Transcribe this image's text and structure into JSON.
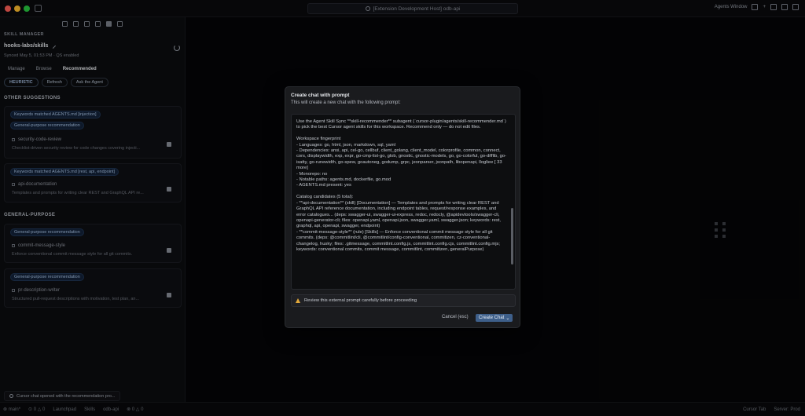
{
  "window": {
    "search_text": "[Extension Development Host] odb-api",
    "right_label": "Agents Window"
  },
  "sidebar": {
    "section_title": "SKILL MANAGER",
    "repo": "hooks-labs/skills",
    "synced": "Synced May 5, 01:53 PM · QS enabled",
    "tabs": [
      "Manage",
      "Browse",
      "Recommended"
    ],
    "active_tab": "Recommended",
    "pills": [
      "HEURISTIC",
      "Refresh",
      "Ask the Agent"
    ],
    "other_title": "OTHER SUGGESTIONS",
    "general_title": "GENERAL-PURPOSE",
    "other_cards": [
      {
        "tags": [
          "Keywords matched AGENTS.md [injection]",
          "General-purpose recommendation"
        ],
        "name": "security-code-review",
        "desc": "Checklist-driven security review for code changes covering injecti..."
      },
      {
        "tags": [
          "Keywords matched AGENTS.md [rest, api, endpoint]"
        ],
        "name": "api-documentation",
        "desc": "Templates and prompts for writing clear REST and GraphQL API re..."
      }
    ],
    "general_cards": [
      {
        "tags": [
          "General-purpose recommendation"
        ],
        "name": "commit-message-style",
        "desc": "Enforce conventional commit message style for all git commits."
      },
      {
        "tags": [
          "General-purpose recommendation"
        ],
        "name": "pr-description-writer",
        "desc": "Structured pull-request descriptions with motivation, test plan, an..."
      }
    ],
    "toast": "Cursor chat opened with the recommendation pro..."
  },
  "statusbar": {
    "left": [
      "⊗ main*",
      "⊙ 0 △ 0",
      "Launchpad",
      "Skills",
      "odb-api",
      "⊗ 0 △ 0"
    ],
    "right": [
      "Cursor Tab",
      "Server: Prod"
    ]
  },
  "modal": {
    "title": "Create chat with prompt",
    "subtitle": "This will create a new chat with the following prompt:",
    "prompt": "Use the Agent Skill Sync **skill-recommender** subagent (`cursor-plugin/agents/skill-recommender.md`) to pick the best Cursor agent skills for this workspace. Recommend only — do not edit files.\n\nWorkspace fingerprint\n- Languages: go, html, json, markdown, sql, yaml\n- Dependencies: ansi, api, cel-go, cellbuf, client_golang, client_model, colorprofile, common, connect, cors, displaywidth, exp, expr, go-cmp-list-go, glob, gnostic, gnostic-models, go, go-colorful, go-difflib, go-isatty, go-runewidth, go-spew, goautoneg, godump, grpc, jeonparser, jsonpath, libopenapi, llogliee [ 33 more]\n- Monorepo: no\n- Notable paths: agents.md, dockerfile, go.mod\n- AGENTS.md present: yes\n\nCatalog candidates (5 total):\n- **api-documentation** (skill) [Documentation] — Templates and prompts for writing clear REST and GraphQL API reference documentation, including endpoint tables, request/response examples, and error catalogues... (deps: swagger-ui, swagger-ui-express, redoc, redocly, @apidevtools/swagger-cli, openapi-generator-cli; files: openapi.yaml, openapi.json, swagger.yaml, swagger.json; keywords: rest, graphql, api, openapi, swagger, endpoint)\n- **commit-message-style** (rule) [Skills] — Enforce conventional commit message style for all git commits. (deps: @commitlint/cli, @commitlint/config-conventional, commitizen, cz-conventional-changelog, husky; files: .gitmessage, commitlint.config.js, commitlint.config.cjs, commitlint.config.mjs; keywords: conventional commits, commit message, commitlint, commitizen, generalPurpose)",
    "warning": "Review this external prompt carefully before proceeding",
    "cancel": "Cancel (esc)",
    "create": "Create Chat",
    "create_chevron": "⌄"
  }
}
